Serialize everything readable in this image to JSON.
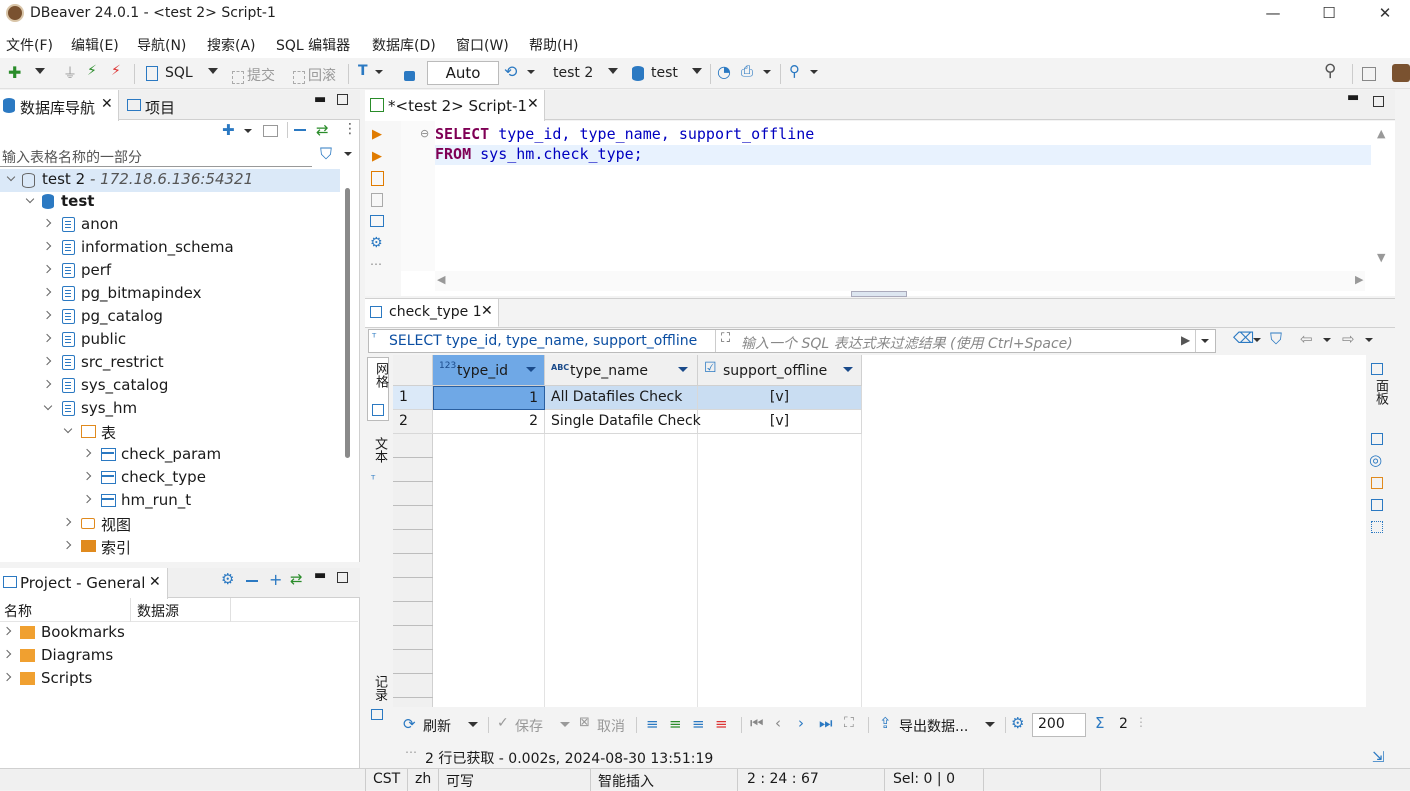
{
  "window": {
    "title": "DBeaver 24.0.1 - <test 2> Script-1"
  },
  "menu": [
    "文件(F)",
    "编辑(E)",
    "导航(N)",
    "搜索(A)",
    "SQL 编辑器",
    "数据库(D)",
    "窗口(W)",
    "帮助(H)"
  ],
  "toolbar": {
    "sql_label": "SQL",
    "commit_label": "提交",
    "rollback_label": "回滚",
    "tx_mode": "Auto",
    "datasource": "test 2",
    "schema": "test"
  },
  "nav": {
    "tab_db": "数据库导航",
    "tab_project": "项目",
    "filter_placeholder": "输入表格名称的一部分",
    "connection": {
      "name": "test 2",
      "address": "- 172.18.6.136:54321"
    },
    "database": "test",
    "schemas": [
      "anon",
      "information_schema",
      "perf",
      "pg_bitmapindex",
      "pg_catalog",
      "public",
      "src_restrict",
      "sys_catalog",
      "sys_hm"
    ],
    "tables_folder": "表",
    "tables": [
      "check_param",
      "check_type",
      "hm_run_t"
    ],
    "views_folder": "视图",
    "index_folder": "索引"
  },
  "project": {
    "tab": "Project - General",
    "col_name": "名称",
    "col_source": "数据源",
    "items": [
      "Bookmarks",
      "Diagrams",
      "Scripts"
    ]
  },
  "editor": {
    "tab": "*<test 2> Script-1",
    "line1_kw": "SELECT",
    "line1_rest": " type_id, type_name, support_offline",
    "line2_kw": "FROM",
    "line2_rest": " sys_hm.check_type;"
  },
  "results": {
    "tab": "check_type 1",
    "query_text": "SELECT type_id, type_name, support_offline",
    "filter_placeholder": "输入一个 SQL 表达式来过滤结果 (使用 Ctrl+Space)",
    "side_grid": "网格",
    "side_text": "文本",
    "side_record": "记录",
    "right_panel": "面板",
    "columns": [
      {
        "badge": "123",
        "name": "type_id"
      },
      {
        "badge": "ABC",
        "name": "type_name"
      },
      {
        "badge": "☑",
        "name": "support_offline"
      }
    ],
    "rows": [
      {
        "n": "1",
        "type_id": "1",
        "type_name": "All Datafiles Check",
        "support_offline": "[v]"
      },
      {
        "n": "2",
        "type_id": "2",
        "type_name": "Single Datafile Check",
        "support_offline": "[v]"
      }
    ],
    "bottom": {
      "refresh": "刷新",
      "save": "保存",
      "cancel": "取消",
      "export": "导出数据...",
      "fetch_size": "200",
      "row_count": "2"
    },
    "status": "2 行已获取 - 0.002s, 2024-08-30 13:51:19"
  },
  "statusbar": {
    "tz": "CST",
    "lang": "zh",
    "writable": "可写",
    "insert_mode": "智能插入",
    "position": "2 : 24 : 67",
    "sel": "Sel: 0 | 0"
  }
}
